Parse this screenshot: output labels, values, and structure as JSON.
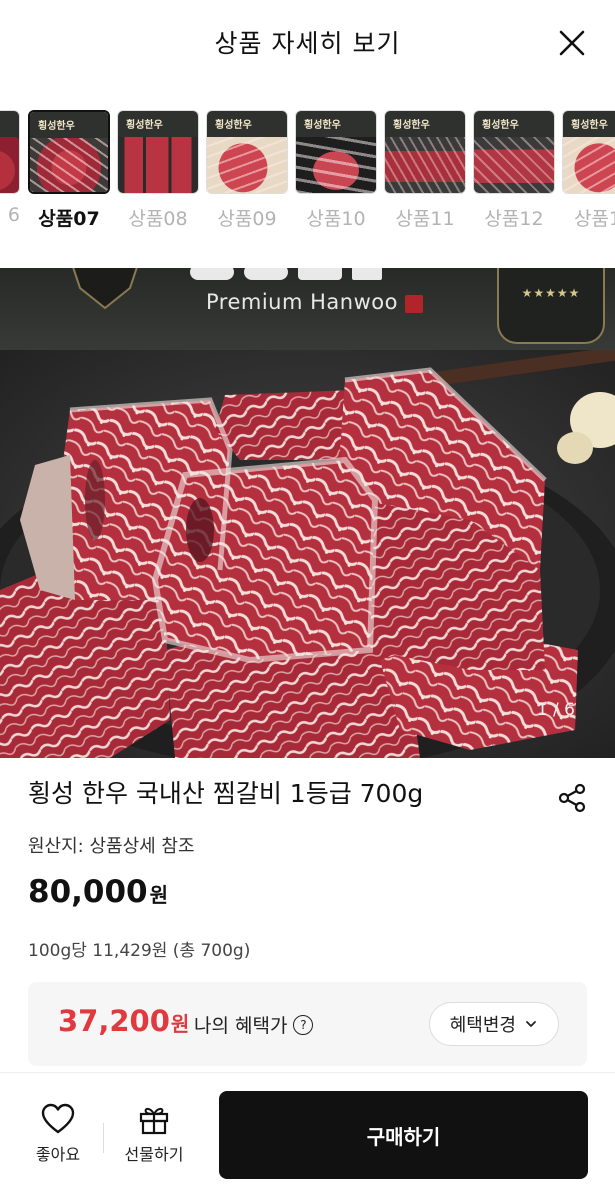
{
  "header": {
    "title": "상품 자세히 보기",
    "close_icon": "close-icon"
  },
  "thumbnails": [
    {
      "label": "6",
      "brand": "",
      "active": false
    },
    {
      "label": "상품07",
      "brand": "횡성한우",
      "active": true
    },
    {
      "label": "상품08",
      "brand": "횡성한우",
      "active": false
    },
    {
      "label": "상품09",
      "brand": "횡성한우",
      "active": false
    },
    {
      "label": "상품10",
      "brand": "횡성한우",
      "active": false
    },
    {
      "label": "상품11",
      "brand": "횡성한우",
      "active": false
    },
    {
      "label": "상품12",
      "brand": "횡성한우",
      "active": false
    },
    {
      "label": "상품1",
      "brand": "횡성한우",
      "active": false
    }
  ],
  "hero": {
    "brand_text": "Premium Hanwoo",
    "counter": "1 / 6"
  },
  "product": {
    "name": "횡성 한우 국내산 찜갈비 1등급 700g",
    "origin": "원산지: 상품상세 참조",
    "price": "80,000",
    "price_unit": "원",
    "unit_price": "100g당 11,429원 (총 700g)"
  },
  "benefit": {
    "price": "37,200",
    "price_unit": "원",
    "label": "나의 혜택가",
    "change_button": "혜택변경"
  },
  "bottom_bar": {
    "like_label": "좋아요",
    "gift_label": "선물하기",
    "buy_label": "구매하기"
  },
  "colors": {
    "accent_red": "#e0393e",
    "buy_button": "#111111",
    "benefit_bg": "#f6f6f6"
  }
}
